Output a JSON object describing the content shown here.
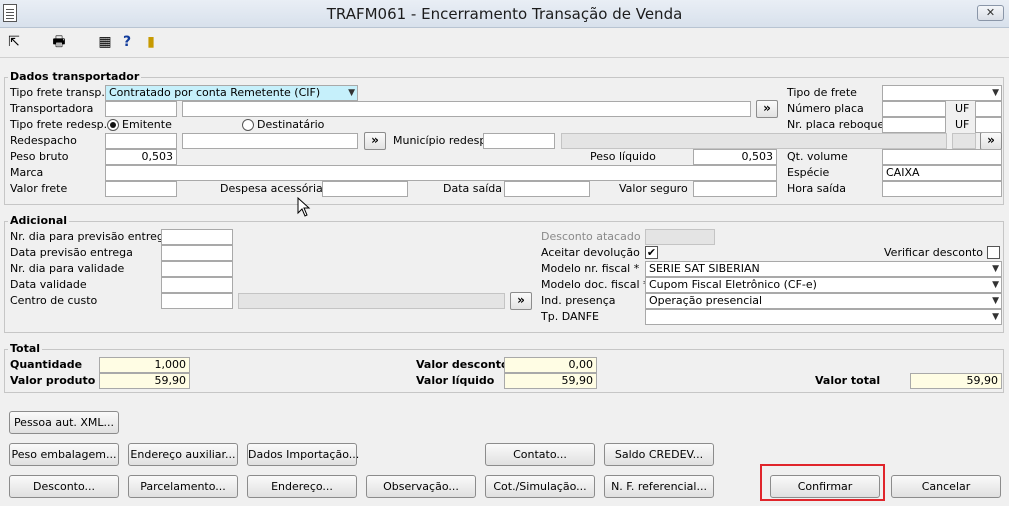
{
  "window": {
    "title": "TRAFM061 - Encerramento Transação de Venda",
    "close_label": "✕"
  },
  "toolbar": {
    "icons": [
      "exit-icon",
      "print-icon",
      "calculator-icon",
      "help-icon",
      "bookmark-icon"
    ]
  },
  "transportador": {
    "title": "Dados transportador",
    "tipo_frete_transp_label": "Tipo frete transp.",
    "tipo_frete_transp_value": "Contratado por conta Remetente (CIF)",
    "transportadora_label": "Transportadora",
    "tipo_frete_redesp_label": "Tipo frete redesp.",
    "emitente_label": "Emitente",
    "destinatario_label": "Destinatário",
    "redespacho_label": "Redespacho",
    "municipio_redesp_label": "Município redesp.",
    "peso_bruto_label": "Peso bruto",
    "peso_bruto_value": "0,503",
    "peso_liquido_label": "Peso líquido",
    "peso_liquido_value": "0,503",
    "marca_label": "Marca",
    "valor_frete_label": "Valor frete",
    "despesa_acessoria_label": "Despesa acessória",
    "data_saida_label": "Data saída",
    "valor_seguro_label": "Valor seguro",
    "tipo_de_frete_label": "Tipo de frete",
    "numero_placa_label": "Número placa",
    "uf_label": "UF",
    "nr_placa_reboque_label": "Nr. placa reboque",
    "qt_volume_label": "Qt. volume",
    "especie_label": "Espécie",
    "especie_value": "CAIXA",
    "hora_saida_label": "Hora saída"
  },
  "adicional": {
    "title": "Adicional",
    "nr_dia_previsao_label": "Nr. dia para previsão entrega",
    "data_previsao_label": "Data previsão entrega",
    "nr_dia_validade_label": "Nr. dia para validade",
    "data_validade_label": "Data validade",
    "centro_custo_label": "Centro de custo",
    "desconto_atacado_label": "Desconto atacado",
    "aceitar_devolucao_label": "Aceitar devolução",
    "verificar_desconto_label": "Verificar desconto",
    "modelo_nr_fiscal_label": "Modelo nr. fiscal *",
    "modelo_nr_fiscal_value": "SERIE SAT SIBERIAN",
    "modelo_doc_fiscal_label": "Modelo doc. fiscal *",
    "modelo_doc_fiscal_value": "Cupom Fiscal Eletrônico (CF-e)",
    "ind_presenca_label": "Ind. presença",
    "ind_presenca_value": "Operação presencial",
    "tp_danfe_label": "Tp. DANFE"
  },
  "total": {
    "title": "Total",
    "quantidade_label": "Quantidade",
    "quantidade_value": "1,000",
    "valor_produto_label": "Valor produto",
    "valor_produto_value": "59,90",
    "valor_desconto_label": "Valor desconto",
    "valor_desconto_value": "0,00",
    "valor_liquido_label": "Valor líquido",
    "valor_liquido_value": "59,90",
    "valor_total_label": "Valor total",
    "valor_total_value": "59,90"
  },
  "buttons": {
    "lookup": "»",
    "pessoa_aut_xml": "Pessoa aut. XML...",
    "peso_embalagem": "Peso embalagem...",
    "endereco_auxiliar": "Endereço auxiliar...",
    "dados_importacao": "Dados Importação...",
    "contato": "Contato...",
    "saldo_credev": "Saldo CREDEV...",
    "desconto": "Desconto...",
    "parcelamento": "Parcelamento...",
    "endereco": "Endereço...",
    "observacao": "Observação...",
    "cot_simulacao": "Cot./Simulação...",
    "nf_referencial": "N. F. referencial...",
    "confirmar": "Confirmar",
    "cancelar": "Cancelar"
  },
  "colors": {
    "highlight": "#e0252b",
    "selected_field": "#c6f0fb",
    "total_field": "#fffde4"
  }
}
